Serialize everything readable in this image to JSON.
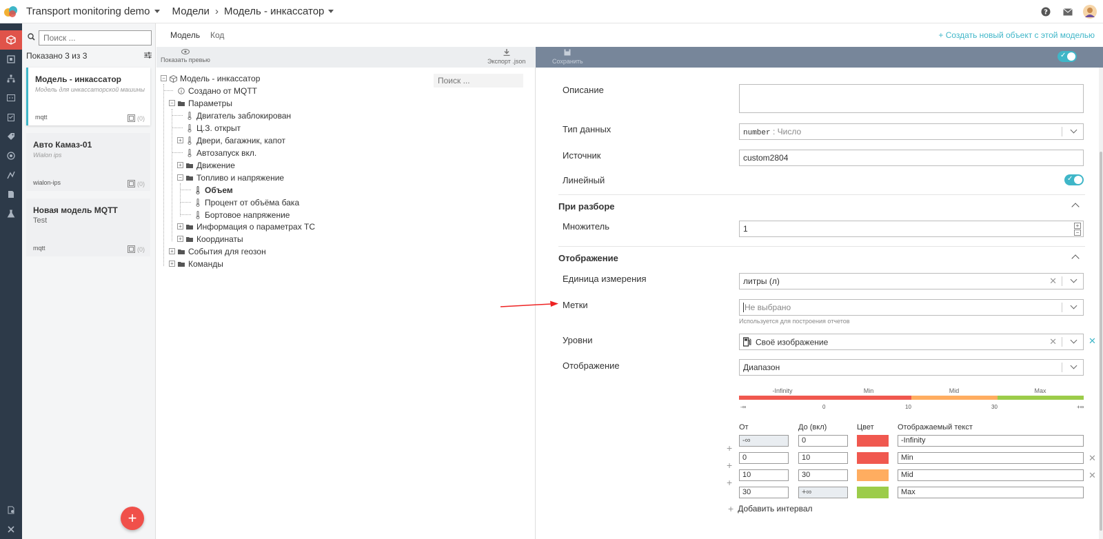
{
  "app": {
    "title": "Transport monitoring demo"
  },
  "breadcrumb": {
    "section": "Модели",
    "separator": "›",
    "current": "Модель - инкассатор"
  },
  "models": {
    "search_placeholder": "Поиск ...",
    "shown_text": "Показано 3 из 3",
    "items": [
      {
        "title": "Модель - инкассатор",
        "subtitle": "Модель для инкассаторской машины",
        "tag": "mqtt",
        "count": "(0)"
      },
      {
        "title": "Авто Камаз-01",
        "subtitle": "Wialon ips",
        "tag": "wialon-ips",
        "count": "(0)"
      },
      {
        "title": "Новая модель MQTT",
        "subtitle": "Test",
        "tag": "mqtt",
        "count": "(0)"
      }
    ]
  },
  "tabs": [
    {
      "label": "Модель"
    },
    {
      "label": "Код"
    }
  ],
  "create_link": "+ Создать новый объект с этой моделью",
  "tree_toolbar": {
    "preview": "Показать превью",
    "export": "Экспорт .json"
  },
  "editor_toolbar": {
    "save": "Сохранить"
  },
  "tree": {
    "search_placeholder": "Поиск ...",
    "nodes": [
      {
        "label": "Модель - инкассатор"
      },
      {
        "label": "Создано от MQTT"
      },
      {
        "label": "Параметры"
      },
      {
        "label": "Двигатель заблокирован"
      },
      {
        "label": "Ц.З. открыт"
      },
      {
        "label": "Двери, багажник, капот"
      },
      {
        "label": "Автозапуск вкл."
      },
      {
        "label": "Движение"
      },
      {
        "label": "Топливо и напряжение"
      },
      {
        "label": "Объем"
      },
      {
        "label": "Процент от объёма бака"
      },
      {
        "label": "Бортовое напряжение"
      },
      {
        "label": "Информация о параметрах ТС"
      },
      {
        "label": "Координаты"
      },
      {
        "label": "События для геозон"
      },
      {
        "label": "Команды"
      }
    ]
  },
  "form": {
    "description_label": "Описание",
    "description_value": "",
    "datatype_label": "Тип данных",
    "datatype_code": "number",
    "datatype_sep": " : ",
    "datatype_name": "Число",
    "source_label": "Источник",
    "source_value": "custom2804",
    "linear_label": "Линейный",
    "parsing_section": "При разборе",
    "multiplier_label": "Множитель",
    "multiplier_value": "1",
    "display_section": "Отображение",
    "unit_label": "Единица измерения",
    "unit_value": "литры (л)",
    "tags_label": "Метки",
    "tags_placeholder": "Не выбрано",
    "tags_hint": "Используется для построения отчетов",
    "levels_label": "Уровни",
    "levels_value": "Своё изображение",
    "display_label": "Отображение",
    "display_value": "Диапазон"
  },
  "range": {
    "labels": [
      "-Infinity",
      "Min",
      "Mid",
      "Max"
    ],
    "ticks": [
      "-∞",
      "0",
      "10",
      "30",
      "+∞"
    ],
    "colors": {
      "red": "#f0584f",
      "orange": "#ffad60",
      "green": "#9ccc4a"
    }
  },
  "intervals": {
    "headers": {
      "from": "От",
      "to": "До (вкл)",
      "color": "Цвет",
      "text": "Отображаемый текст"
    },
    "rows": [
      {
        "from": "-∞",
        "to": "0",
        "color": "#f0584f",
        "text": "-Infinity"
      },
      {
        "from": "0",
        "to": "10",
        "color": "#f0584f",
        "text": "Min"
      },
      {
        "from": "10",
        "to": "30",
        "color": "#ffad60",
        "text": "Mid"
      },
      {
        "from": "30",
        "to": "+∞",
        "color": "#9ccc4a",
        "text": "Max"
      }
    ],
    "add_label": "Добавить интервал"
  }
}
